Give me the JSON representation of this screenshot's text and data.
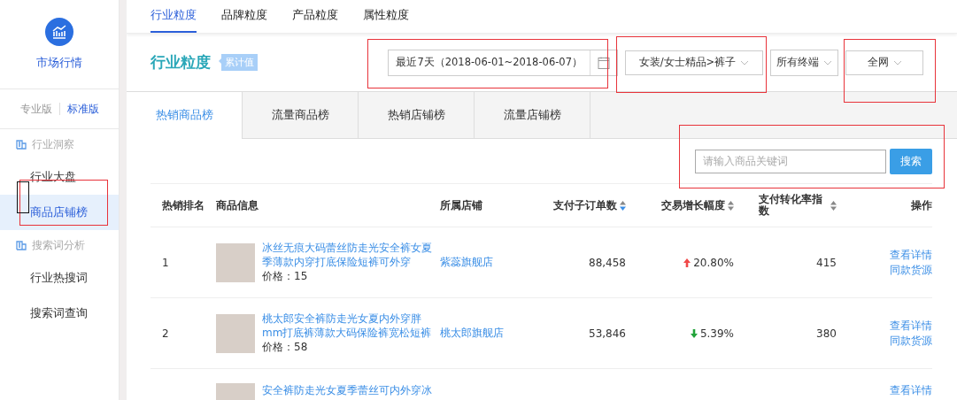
{
  "sidebar": {
    "title": "市场行情",
    "versions": [
      {
        "label": "专业版",
        "selected": false
      },
      {
        "label": "标准版",
        "selected": true
      }
    ],
    "sections": [
      {
        "label": "行业洞察",
        "items": [
          {
            "label": "行业大盘",
            "selected": false
          },
          {
            "label": "商品店铺榜",
            "selected": true
          }
        ]
      },
      {
        "label": "搜索词分析",
        "items": [
          {
            "label": "行业热搜词",
            "selected": false
          },
          {
            "label": "搜索词查询",
            "selected": false
          }
        ]
      }
    ]
  },
  "top_tabs": [
    {
      "label": "行业粒度",
      "selected": true
    },
    {
      "label": "品牌粒度",
      "selected": false
    },
    {
      "label": "产品粒度",
      "selected": false
    },
    {
      "label": "属性粒度",
      "selected": false
    }
  ],
  "header": {
    "title": "行业粒度",
    "badge": "累计值",
    "date_range": "最近7天（2018-06-01~2018-06-07）",
    "category": "女装/女士精品>裤子",
    "terminal": "所有终端",
    "channel": "全网"
  },
  "rank_tabs": [
    {
      "label": "热销商品榜",
      "selected": true
    },
    {
      "label": "流量商品榜",
      "selected": false
    },
    {
      "label": "热销店铺榜",
      "selected": false
    },
    {
      "label": "流量店铺榜",
      "selected": false
    }
  ],
  "search": {
    "placeholder": "请输入商品关键词",
    "button": "搜索"
  },
  "table": {
    "columns": [
      {
        "label": "热销排名",
        "sortable": false,
        "sorted": false
      },
      {
        "label": "商品信息",
        "sortable": false,
        "sorted": false
      },
      {
        "label": "所属店铺",
        "sortable": false,
        "sorted": false
      },
      {
        "label": "支付子订单数",
        "sortable": true,
        "sorted": true
      },
      {
        "label": "交易增长幅度",
        "sortable": true,
        "sorted": false
      },
      {
        "label": "支付转化率指数",
        "sortable": true,
        "sorted": false
      },
      {
        "label": "操作",
        "sortable": false,
        "sorted": false
      }
    ],
    "rows": [
      {
        "rank": "1",
        "title": "冰丝无痕大码蕾丝防走光安全裤女夏季薄款内穿打底保险短裤可外穿",
        "price": "价格：15",
        "store": "紫蕊旗舰店",
        "orders": "88,458",
        "rising": true,
        "growth": "20.80%",
        "conversion": "415",
        "actions": [
          "查看详情",
          "同款货源"
        ]
      },
      {
        "rank": "2",
        "title": "桃太郎安全裤防走光女夏内外穿胖mm打底裤薄款大码保险裤宽松短裤",
        "price": "价格：58",
        "store": "桃太郎旗舰店",
        "orders": "53,846",
        "rising": false,
        "growth": "5.39%",
        "conversion": "380",
        "actions": [
          "查看详情",
          "同款货源"
        ]
      },
      {
        "title": "安全裤防走光女夏季蕾丝可内外穿冰",
        "actions": [
          "查看详情"
        ]
      }
    ]
  }
}
